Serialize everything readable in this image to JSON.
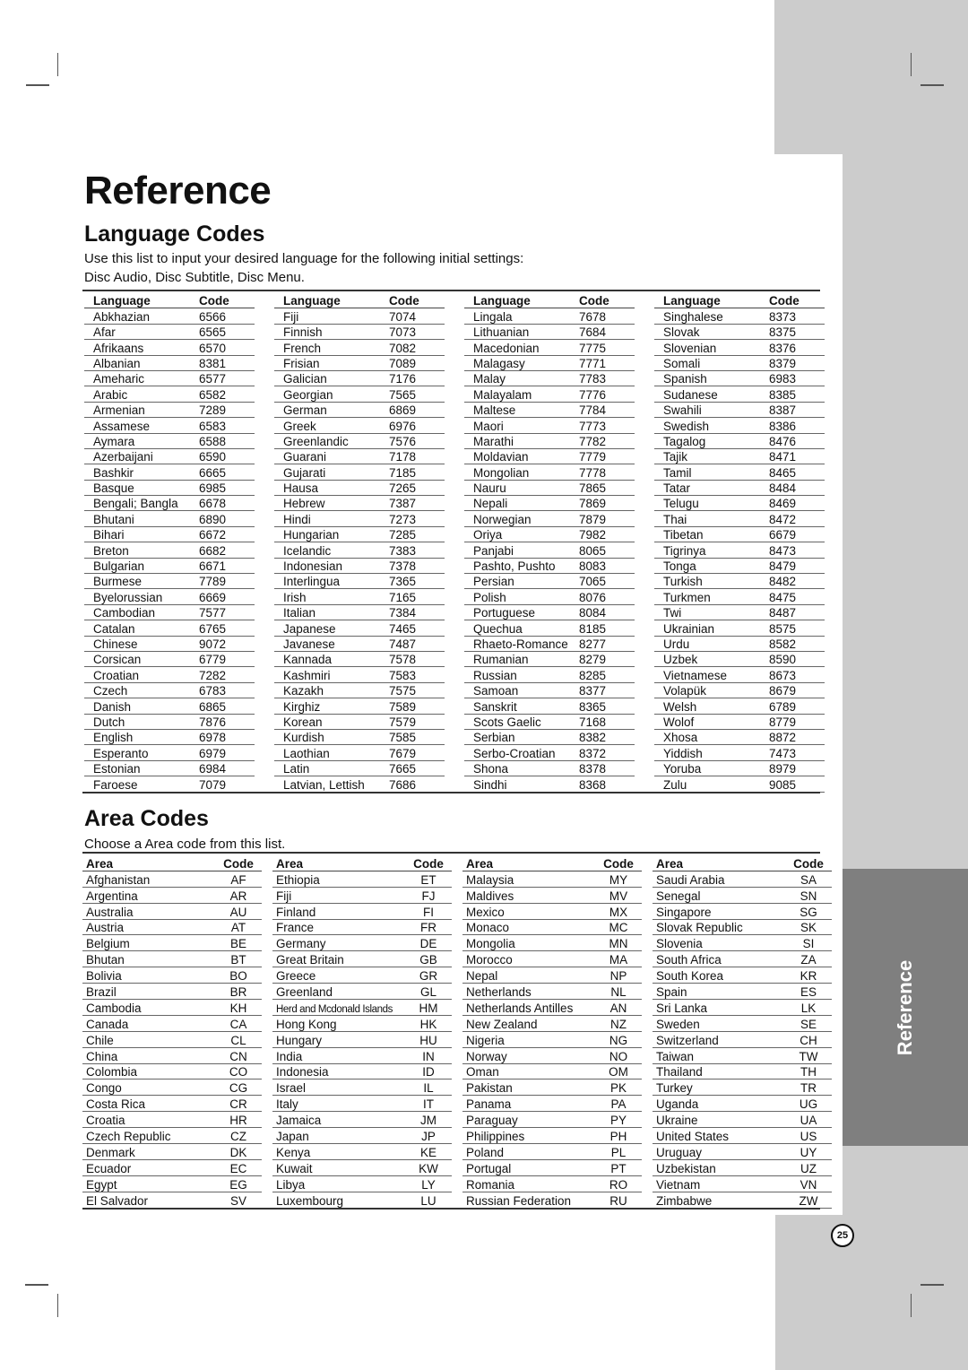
{
  "page": {
    "title": "Reference",
    "side_tab": "Reference",
    "page_number": "25"
  },
  "language": {
    "heading": "Language Codes",
    "intro_line1": "Use this list to input your desired language for the following initial settings:",
    "intro_line2": "Disc Audio, Disc Subtitle, Disc Menu.",
    "col_language": "Language",
    "col_code": "Code",
    "columns": [
      [
        [
          "Abkhazian",
          "6566"
        ],
        [
          "Afar",
          "6565"
        ],
        [
          "Afrikaans",
          "6570"
        ],
        [
          "Albanian",
          "8381"
        ],
        [
          "Ameharic",
          "6577"
        ],
        [
          "Arabic",
          "6582"
        ],
        [
          "Armenian",
          "7289"
        ],
        [
          "Assamese",
          "6583"
        ],
        [
          "Aymara",
          "6588"
        ],
        [
          "Azerbaijani",
          "6590"
        ],
        [
          "Bashkir",
          "6665"
        ],
        [
          "Basque",
          "6985"
        ],
        [
          "Bengali; Bangla",
          "6678"
        ],
        [
          "Bhutani",
          "6890"
        ],
        [
          "Bihari",
          "6672"
        ],
        [
          "Breton",
          "6682"
        ],
        [
          "Bulgarian",
          "6671"
        ],
        [
          "Burmese",
          "7789"
        ],
        [
          "Byelorussian",
          "6669"
        ],
        [
          "Cambodian",
          "7577"
        ],
        [
          "Catalan",
          "6765"
        ],
        [
          "Chinese",
          "9072"
        ],
        [
          "Corsican",
          "6779"
        ],
        [
          "Croatian",
          "7282"
        ],
        [
          "Czech",
          "6783"
        ],
        [
          "Danish",
          "6865"
        ],
        [
          "Dutch",
          "7876"
        ],
        [
          "English",
          "6978"
        ],
        [
          "Esperanto",
          "6979"
        ],
        [
          "Estonian",
          "6984"
        ],
        [
          "Faroese",
          "7079"
        ]
      ],
      [
        [
          "Fiji",
          "7074"
        ],
        [
          "Finnish",
          "7073"
        ],
        [
          "French",
          "7082"
        ],
        [
          "Frisian",
          "7089"
        ],
        [
          "Galician",
          "7176"
        ],
        [
          "Georgian",
          "7565"
        ],
        [
          "German",
          "6869"
        ],
        [
          "Greek",
          "6976"
        ],
        [
          "Greenlandic",
          "7576"
        ],
        [
          "Guarani",
          "7178"
        ],
        [
          "Gujarati",
          "7185"
        ],
        [
          "Hausa",
          "7265"
        ],
        [
          "Hebrew",
          "7387"
        ],
        [
          "Hindi",
          "7273"
        ],
        [
          "Hungarian",
          "7285"
        ],
        [
          "Icelandic",
          "7383"
        ],
        [
          "Indonesian",
          "7378"
        ],
        [
          "Interlingua",
          "7365"
        ],
        [
          "Irish",
          "7165"
        ],
        [
          "Italian",
          "7384"
        ],
        [
          "Japanese",
          "7465"
        ],
        [
          "Javanese",
          "7487"
        ],
        [
          "Kannada",
          "7578"
        ],
        [
          "Kashmiri",
          "7583"
        ],
        [
          "Kazakh",
          "7575"
        ],
        [
          "Kirghiz",
          "7589"
        ],
        [
          "Korean",
          "7579"
        ],
        [
          "Kurdish",
          "7585"
        ],
        [
          "Laothian",
          "7679"
        ],
        [
          "Latin",
          "7665"
        ],
        [
          "Latvian, Lettish",
          "7686"
        ]
      ],
      [
        [
          "Lingala",
          "7678"
        ],
        [
          "Lithuanian",
          "7684"
        ],
        [
          "Macedonian",
          "7775"
        ],
        [
          "Malagasy",
          "7771"
        ],
        [
          "Malay",
          "7783"
        ],
        [
          "Malayalam",
          "7776"
        ],
        [
          "Maltese",
          "7784"
        ],
        [
          "Maori",
          "7773"
        ],
        [
          "Marathi",
          "7782"
        ],
        [
          "Moldavian",
          "7779"
        ],
        [
          "Mongolian",
          "7778"
        ],
        [
          "Nauru",
          "7865"
        ],
        [
          "Nepali",
          "7869"
        ],
        [
          "Norwegian",
          "7879"
        ],
        [
          "Oriya",
          "7982"
        ],
        [
          "Panjabi",
          "8065"
        ],
        [
          "Pashto, Pushto",
          "8083"
        ],
        [
          "Persian",
          "7065"
        ],
        [
          "Polish",
          "8076"
        ],
        [
          "Portuguese",
          "8084"
        ],
        [
          "Quechua",
          "8185"
        ],
        [
          "Rhaeto-Romance",
          "8277"
        ],
        [
          "Rumanian",
          "8279"
        ],
        [
          "Russian",
          "8285"
        ],
        [
          "Samoan",
          "8377"
        ],
        [
          "Sanskrit",
          "8365"
        ],
        [
          "Scots Gaelic",
          "7168"
        ],
        [
          "Serbian",
          "8382"
        ],
        [
          "Serbo-Croatian",
          "8372"
        ],
        [
          "Shona",
          "8378"
        ],
        [
          "Sindhi",
          "8368"
        ]
      ],
      [
        [
          "Singhalese",
          "8373"
        ],
        [
          "Slovak",
          "8375"
        ],
        [
          "Slovenian",
          "8376"
        ],
        [
          "Somali",
          "8379"
        ],
        [
          "Spanish",
          "6983"
        ],
        [
          "Sudanese",
          "8385"
        ],
        [
          "Swahili",
          "8387"
        ],
        [
          "Swedish",
          "8386"
        ],
        [
          "Tagalog",
          "8476"
        ],
        [
          "Tajik",
          "8471"
        ],
        [
          "Tamil",
          "8465"
        ],
        [
          "Tatar",
          "8484"
        ],
        [
          "Telugu",
          "8469"
        ],
        [
          "Thai",
          "8472"
        ],
        [
          "Tibetan",
          "6679"
        ],
        [
          "Tigrinya",
          "8473"
        ],
        [
          "Tonga",
          "8479"
        ],
        [
          "Turkish",
          "8482"
        ],
        [
          "Turkmen",
          "8475"
        ],
        [
          "Twi",
          "8487"
        ],
        [
          "Ukrainian",
          "8575"
        ],
        [
          "Urdu",
          "8582"
        ],
        [
          "Uzbek",
          "8590"
        ],
        [
          "Vietnamese",
          "8673"
        ],
        [
          "Volapük",
          "8679"
        ],
        [
          "Welsh",
          "6789"
        ],
        [
          "Wolof",
          "8779"
        ],
        [
          "Xhosa",
          "8872"
        ],
        [
          "Yiddish",
          "7473"
        ],
        [
          "Yoruba",
          "8979"
        ],
        [
          "Zulu",
          "9085"
        ]
      ]
    ]
  },
  "area": {
    "heading": "Area Codes",
    "intro": "Choose a Area code from this list.",
    "col_area": "Area",
    "col_code": "Code",
    "columns": [
      [
        [
          "Afghanistan",
          "AF"
        ],
        [
          "Argentina",
          "AR"
        ],
        [
          "Australia",
          "AU"
        ],
        [
          "Austria",
          "AT"
        ],
        [
          "Belgium",
          "BE"
        ],
        [
          "Bhutan",
          "BT"
        ],
        [
          "Bolivia",
          "BO"
        ],
        [
          "Brazil",
          "BR"
        ],
        [
          "Cambodia",
          "KH"
        ],
        [
          "Canada",
          "CA"
        ],
        [
          "Chile",
          "CL"
        ],
        [
          "China",
          "CN"
        ],
        [
          "Colombia",
          "CO"
        ],
        [
          "Congo",
          "CG"
        ],
        [
          "Costa Rica",
          "CR"
        ],
        [
          "Croatia",
          "HR"
        ],
        [
          "Czech Republic",
          "CZ"
        ],
        [
          "Denmark",
          "DK"
        ],
        [
          "Ecuador",
          "EC"
        ],
        [
          "Egypt",
          "EG"
        ],
        [
          "El Salvador",
          "SV"
        ]
      ],
      [
        [
          "Ethiopia",
          "ET"
        ],
        [
          "Fiji",
          "FJ"
        ],
        [
          "Finland",
          "FI"
        ],
        [
          "France",
          "FR"
        ],
        [
          "Germany",
          "DE"
        ],
        [
          "Great Britain",
          "GB"
        ],
        [
          "Greece",
          "GR"
        ],
        [
          "Greenland",
          "GL"
        ],
        [
          "Herd and Mcdonald Islands",
          "HM"
        ],
        [
          "Hong Kong",
          "HK"
        ],
        [
          "Hungary",
          "HU"
        ],
        [
          "India",
          "IN"
        ],
        [
          "Indonesia",
          "ID"
        ],
        [
          "Israel",
          "IL"
        ],
        [
          "Italy",
          "IT"
        ],
        [
          "Jamaica",
          "JM"
        ],
        [
          "Japan",
          "JP"
        ],
        [
          "Kenya",
          "KE"
        ],
        [
          "Kuwait",
          "KW"
        ],
        [
          "Libya",
          "LY"
        ],
        [
          "Luxembourg",
          "LU"
        ]
      ],
      [
        [
          "Malaysia",
          "MY"
        ],
        [
          "Maldives",
          "MV"
        ],
        [
          "Mexico",
          "MX"
        ],
        [
          "Monaco",
          "MC"
        ],
        [
          "Mongolia",
          "MN"
        ],
        [
          "Morocco",
          "MA"
        ],
        [
          "Nepal",
          "NP"
        ],
        [
          "Netherlands",
          "NL"
        ],
        [
          "Netherlands Antilles",
          "AN"
        ],
        [
          "New Zealand",
          "NZ"
        ],
        [
          "Nigeria",
          "NG"
        ],
        [
          "Norway",
          "NO"
        ],
        [
          "Oman",
          "OM"
        ],
        [
          "Pakistan",
          "PK"
        ],
        [
          "Panama",
          "PA"
        ],
        [
          "Paraguay",
          "PY"
        ],
        [
          "Philippines",
          "PH"
        ],
        [
          "Poland",
          "PL"
        ],
        [
          "Portugal",
          "PT"
        ],
        [
          "Romania",
          "RO"
        ],
        [
          "Russian Federation",
          "RU"
        ]
      ],
      [
        [
          "Saudi Arabia",
          "SA"
        ],
        [
          "Senegal",
          "SN"
        ],
        [
          "Singapore",
          "SG"
        ],
        [
          "Slovak Republic",
          "SK"
        ],
        [
          "Slovenia",
          "SI"
        ],
        [
          "South Africa",
          "ZA"
        ],
        [
          "South Korea",
          "KR"
        ],
        [
          "Spain",
          "ES"
        ],
        [
          "Sri Lanka",
          "LK"
        ],
        [
          "Sweden",
          "SE"
        ],
        [
          "Switzerland",
          "CH"
        ],
        [
          "Taiwan",
          "TW"
        ],
        [
          "Thailand",
          "TH"
        ],
        [
          "Turkey",
          "TR"
        ],
        [
          "Uganda",
          "UG"
        ],
        [
          "Ukraine",
          "UA"
        ],
        [
          "United States",
          "US"
        ],
        [
          "Uruguay",
          "UY"
        ],
        [
          "Uzbekistan",
          "UZ"
        ],
        [
          "Vietnam",
          "VN"
        ],
        [
          "Zimbabwe",
          "ZW"
        ]
      ]
    ]
  }
}
